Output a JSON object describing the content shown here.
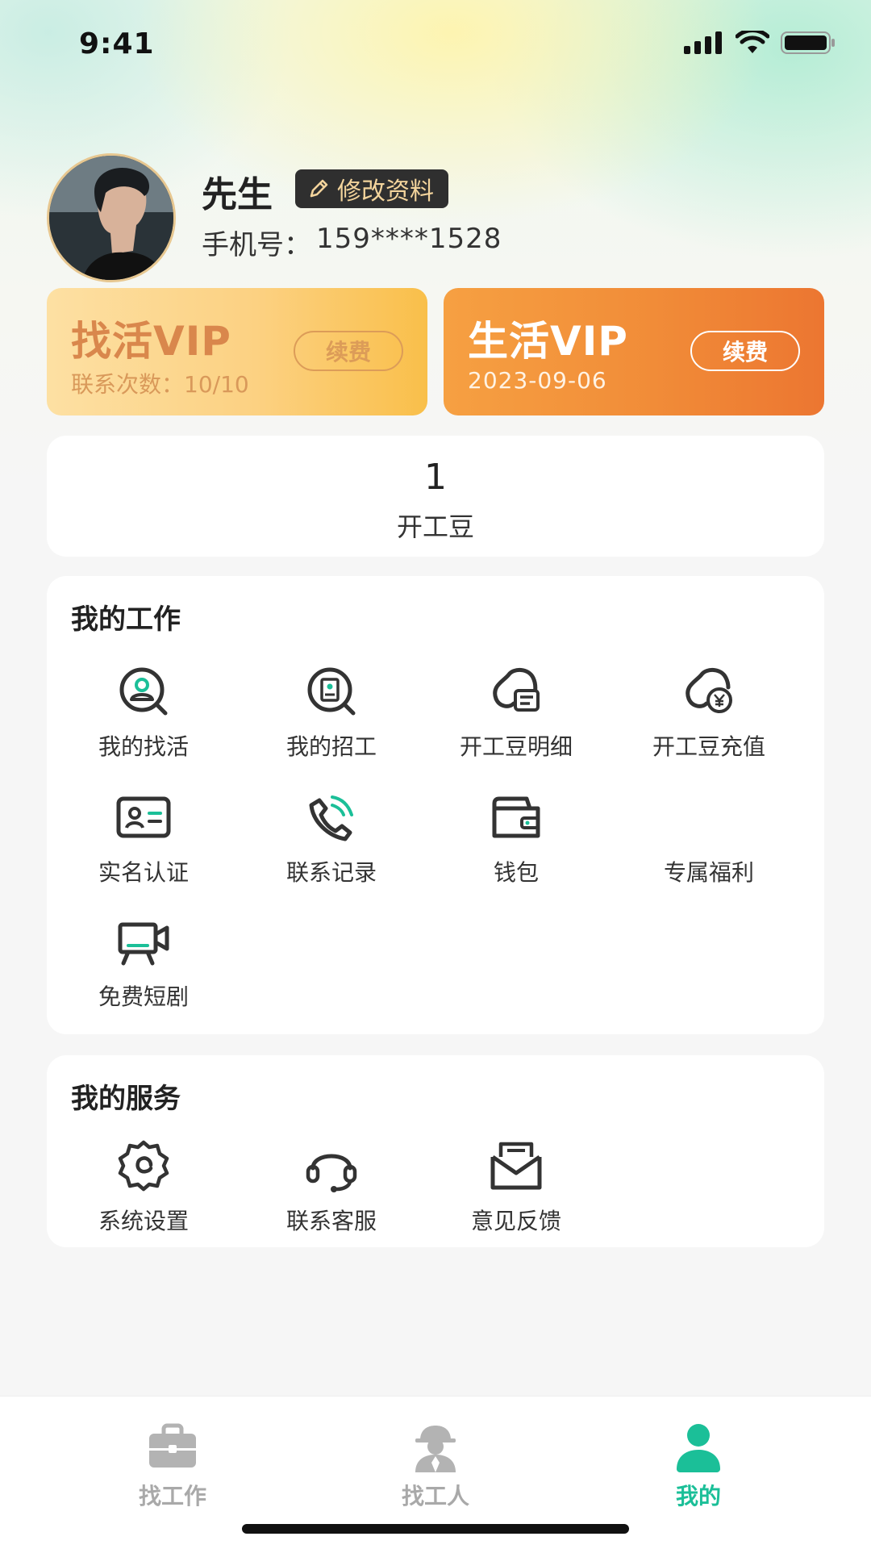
{
  "status_bar": {
    "time": "9:41"
  },
  "profile": {
    "name": "先生",
    "edit_label": "修改资料",
    "phone_label": "手机号：",
    "phone": "159****1528"
  },
  "vip": {
    "find": {
      "title": "找活VIP",
      "subtitle": "联系次数：10/10",
      "renew": "续费"
    },
    "life": {
      "title": "生活VIP",
      "subtitle": "2023-09-06",
      "renew": "续费"
    }
  },
  "beans": {
    "count": "1",
    "label": "开工豆"
  },
  "my_work": {
    "title": "我的工作",
    "items": [
      {
        "label": "我的找活",
        "icon": "search-worker-icon"
      },
      {
        "label": "我的招工",
        "icon": "search-document-icon"
      },
      {
        "label": "开工豆明细",
        "icon": "bean-detail-icon"
      },
      {
        "label": "开工豆充值",
        "icon": "bean-recharge-icon"
      },
      {
        "label": "实名认证",
        "icon": "id-card-icon"
      },
      {
        "label": "联系记录",
        "icon": "phone-call-icon"
      },
      {
        "label": "钱包",
        "icon": "wallet-icon"
      },
      {
        "label": "专属福利",
        "icon": "gift-icon"
      },
      {
        "label": "免费短剧",
        "icon": "video-camera-icon"
      }
    ]
  },
  "my_service": {
    "title": "我的服务",
    "items": [
      {
        "label": "系统设置",
        "icon": "settings-icon"
      },
      {
        "label": "联系客服",
        "icon": "headset-icon"
      },
      {
        "label": "意见反馈",
        "icon": "feedback-mail-icon"
      }
    ]
  },
  "tab_bar": {
    "tabs": [
      {
        "label": "找工作",
        "icon": "briefcase-icon",
        "active": false
      },
      {
        "label": "找工人",
        "icon": "worker-icon",
        "active": false
      },
      {
        "label": "我的",
        "icon": "profile-icon",
        "active": true
      }
    ]
  },
  "colors": {
    "accent": "#1bbf98",
    "icon_dark": "#333333",
    "vip_orange": "#ec7631",
    "vip_gold": "#f9bf4a"
  }
}
